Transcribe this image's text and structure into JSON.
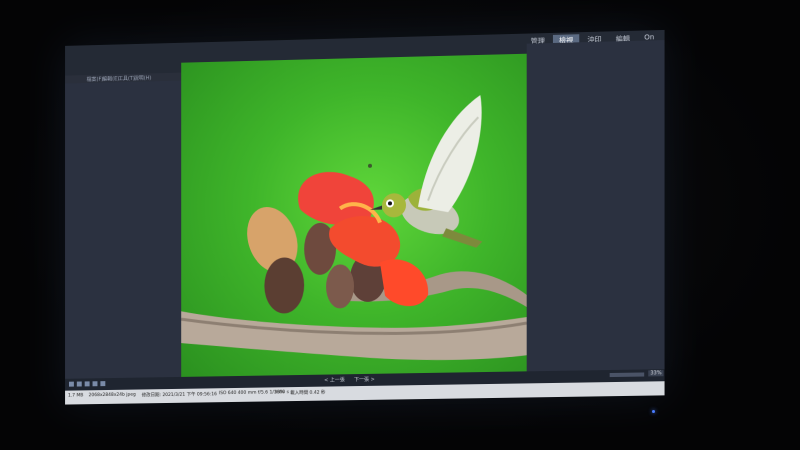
{
  "app": {
    "menu": [
      "檔案(F)",
      "編輯(E)",
      "工具(T)",
      "說明(H)"
    ],
    "nav_tabs": [
      {
        "label": "管理",
        "active": false
      },
      {
        "label": "檢視",
        "active": true
      },
      {
        "label": "沖印",
        "active": false
      },
      {
        "label": "編輯",
        "active": false
      },
      {
        "label": "On",
        "active": false
      }
    ]
  },
  "bottom_bar": {
    "prev_label": "< 上一張",
    "next_label": "下一張 >",
    "zoom": "33%"
  },
  "status": {
    "filesize": "1.7 MB",
    "dimensions": "2068x2848x24b jpeg",
    "date_label": "修改日期: 2021/3/21 下午 09:56:16",
    "exif": "ISO 640  400 mm  f/5.6  1/1600 s",
    "zoom_pct": "33%",
    "loaded": "載入時間 0.42 秒"
  },
  "colors": {
    "screen_bg": "#2a2f3b",
    "accent_tab": "#5b6a82",
    "photo_green": "#3fb52a"
  }
}
